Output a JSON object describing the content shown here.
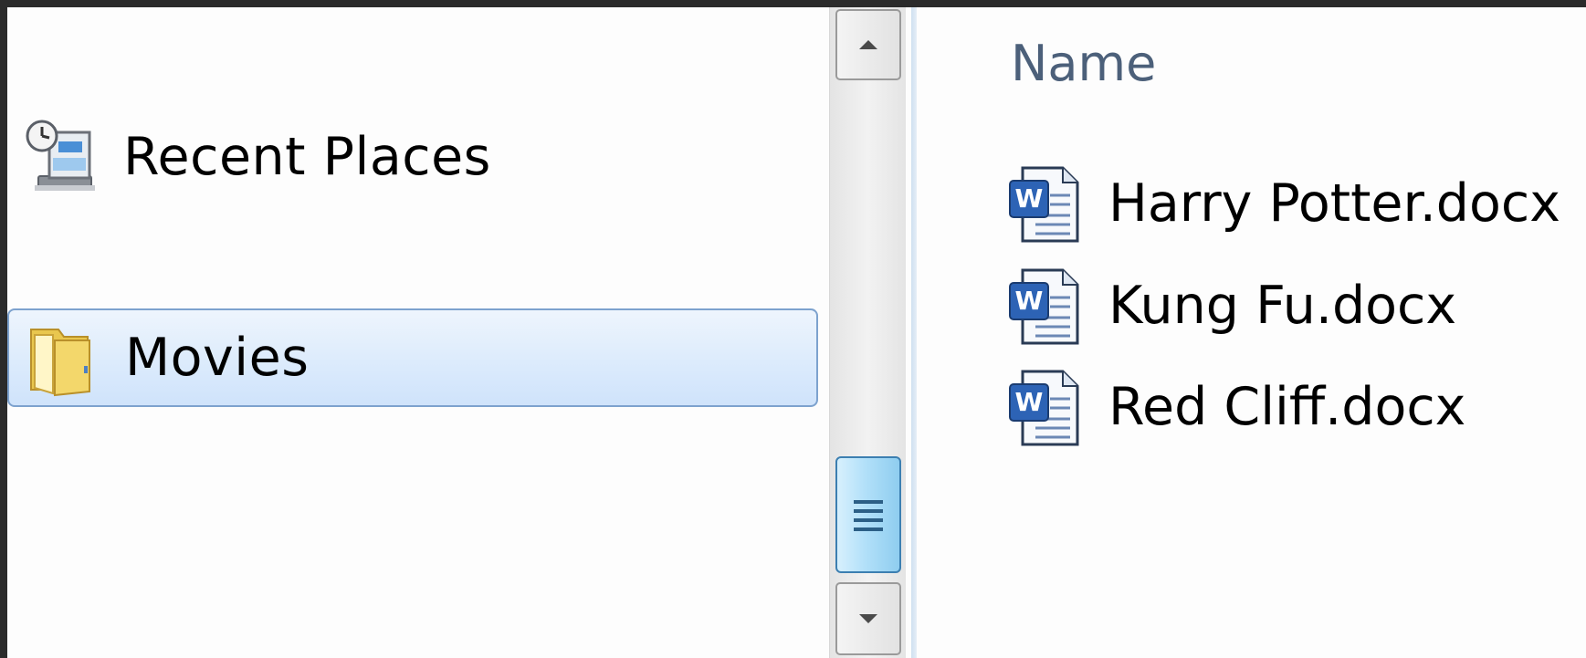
{
  "navigation": {
    "items": [
      {
        "label": "Recent Places",
        "icon": "recent-places-icon",
        "selected": false
      },
      {
        "label": "Movies",
        "icon": "folder-icon",
        "selected": true
      }
    ]
  },
  "scrollbar": {
    "up_icon": "arrow-up-icon",
    "down_icon": "arrow-down-icon",
    "thumb_icon": "grip-icon"
  },
  "content": {
    "column_header": "Name",
    "files": [
      {
        "name": "Harry Potter.docx",
        "icon": "word-document-icon"
      },
      {
        "name": "Kung Fu.docx",
        "icon": "word-document-icon"
      },
      {
        "name": "Red Cliff.docx",
        "icon": "word-document-icon"
      }
    ]
  },
  "colors": {
    "selection_border": "#7da2ce",
    "selection_fill": "#dcebfc",
    "header_text": "#4c607a",
    "thumb_fill": "#b2e0f9",
    "thumb_border": "#3c7fb1"
  }
}
